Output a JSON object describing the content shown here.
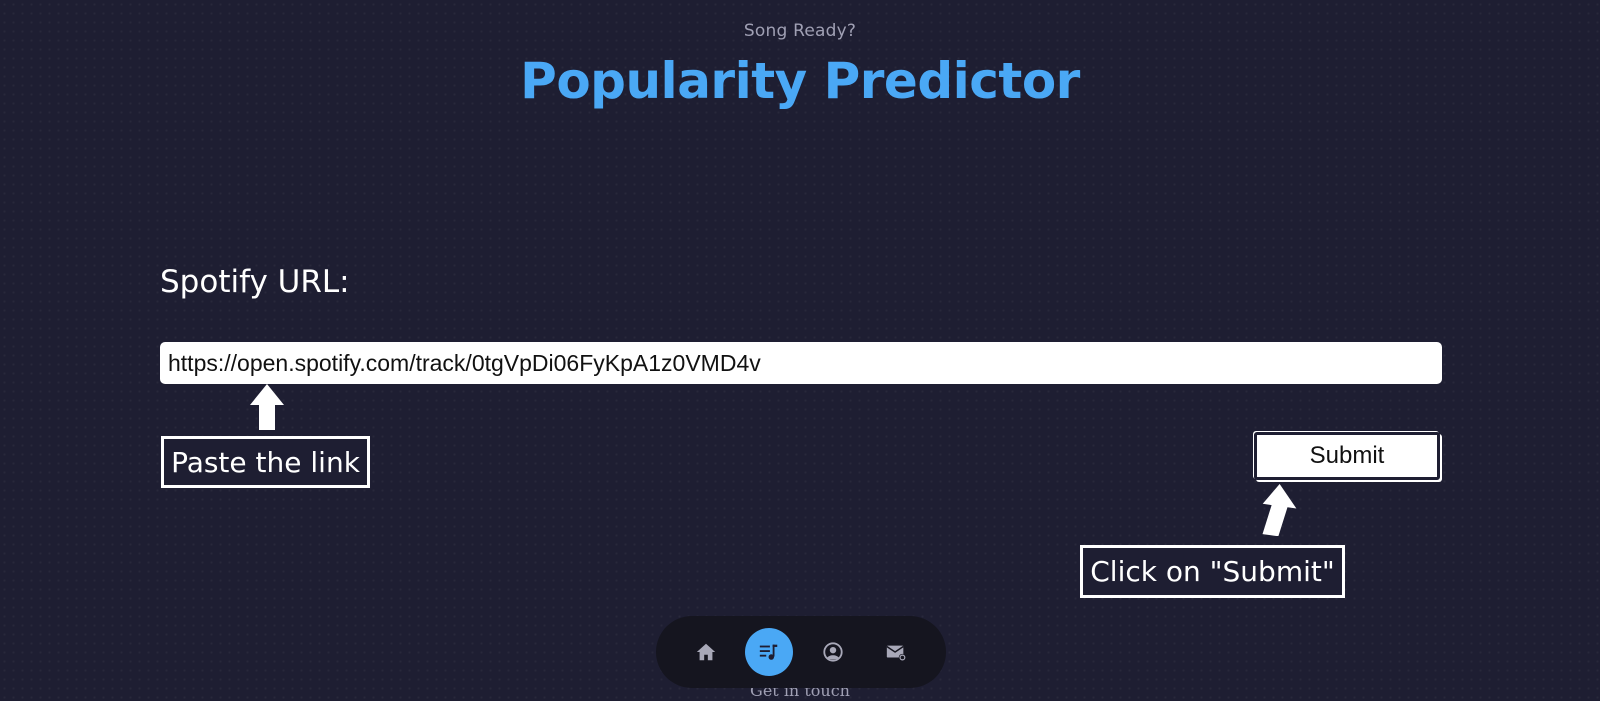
{
  "header": {
    "subtitle": "Song Ready?",
    "title": "Popularity Predictor"
  },
  "form": {
    "url_label": "Spotify URL:",
    "url_value": "https://open.spotify.com/track/0tgVpDi06FyKpA1z0VMD4v",
    "submit_label": "Submit"
  },
  "annotations": {
    "paste_hint": "Paste the link",
    "submit_hint": "Click on \"Submit\""
  },
  "nav": {
    "items": [
      {
        "icon": "home-icon",
        "active": false
      },
      {
        "icon": "music-playlist-icon",
        "active": true
      },
      {
        "icon": "user-circle-icon",
        "active": false
      },
      {
        "icon": "mail-icon",
        "active": false
      }
    ]
  },
  "footer": {
    "peek_text": "Get in touch"
  },
  "colors": {
    "background": "#1e1e32",
    "accent": "#4aa8f5",
    "nav_background": "#15151f"
  }
}
